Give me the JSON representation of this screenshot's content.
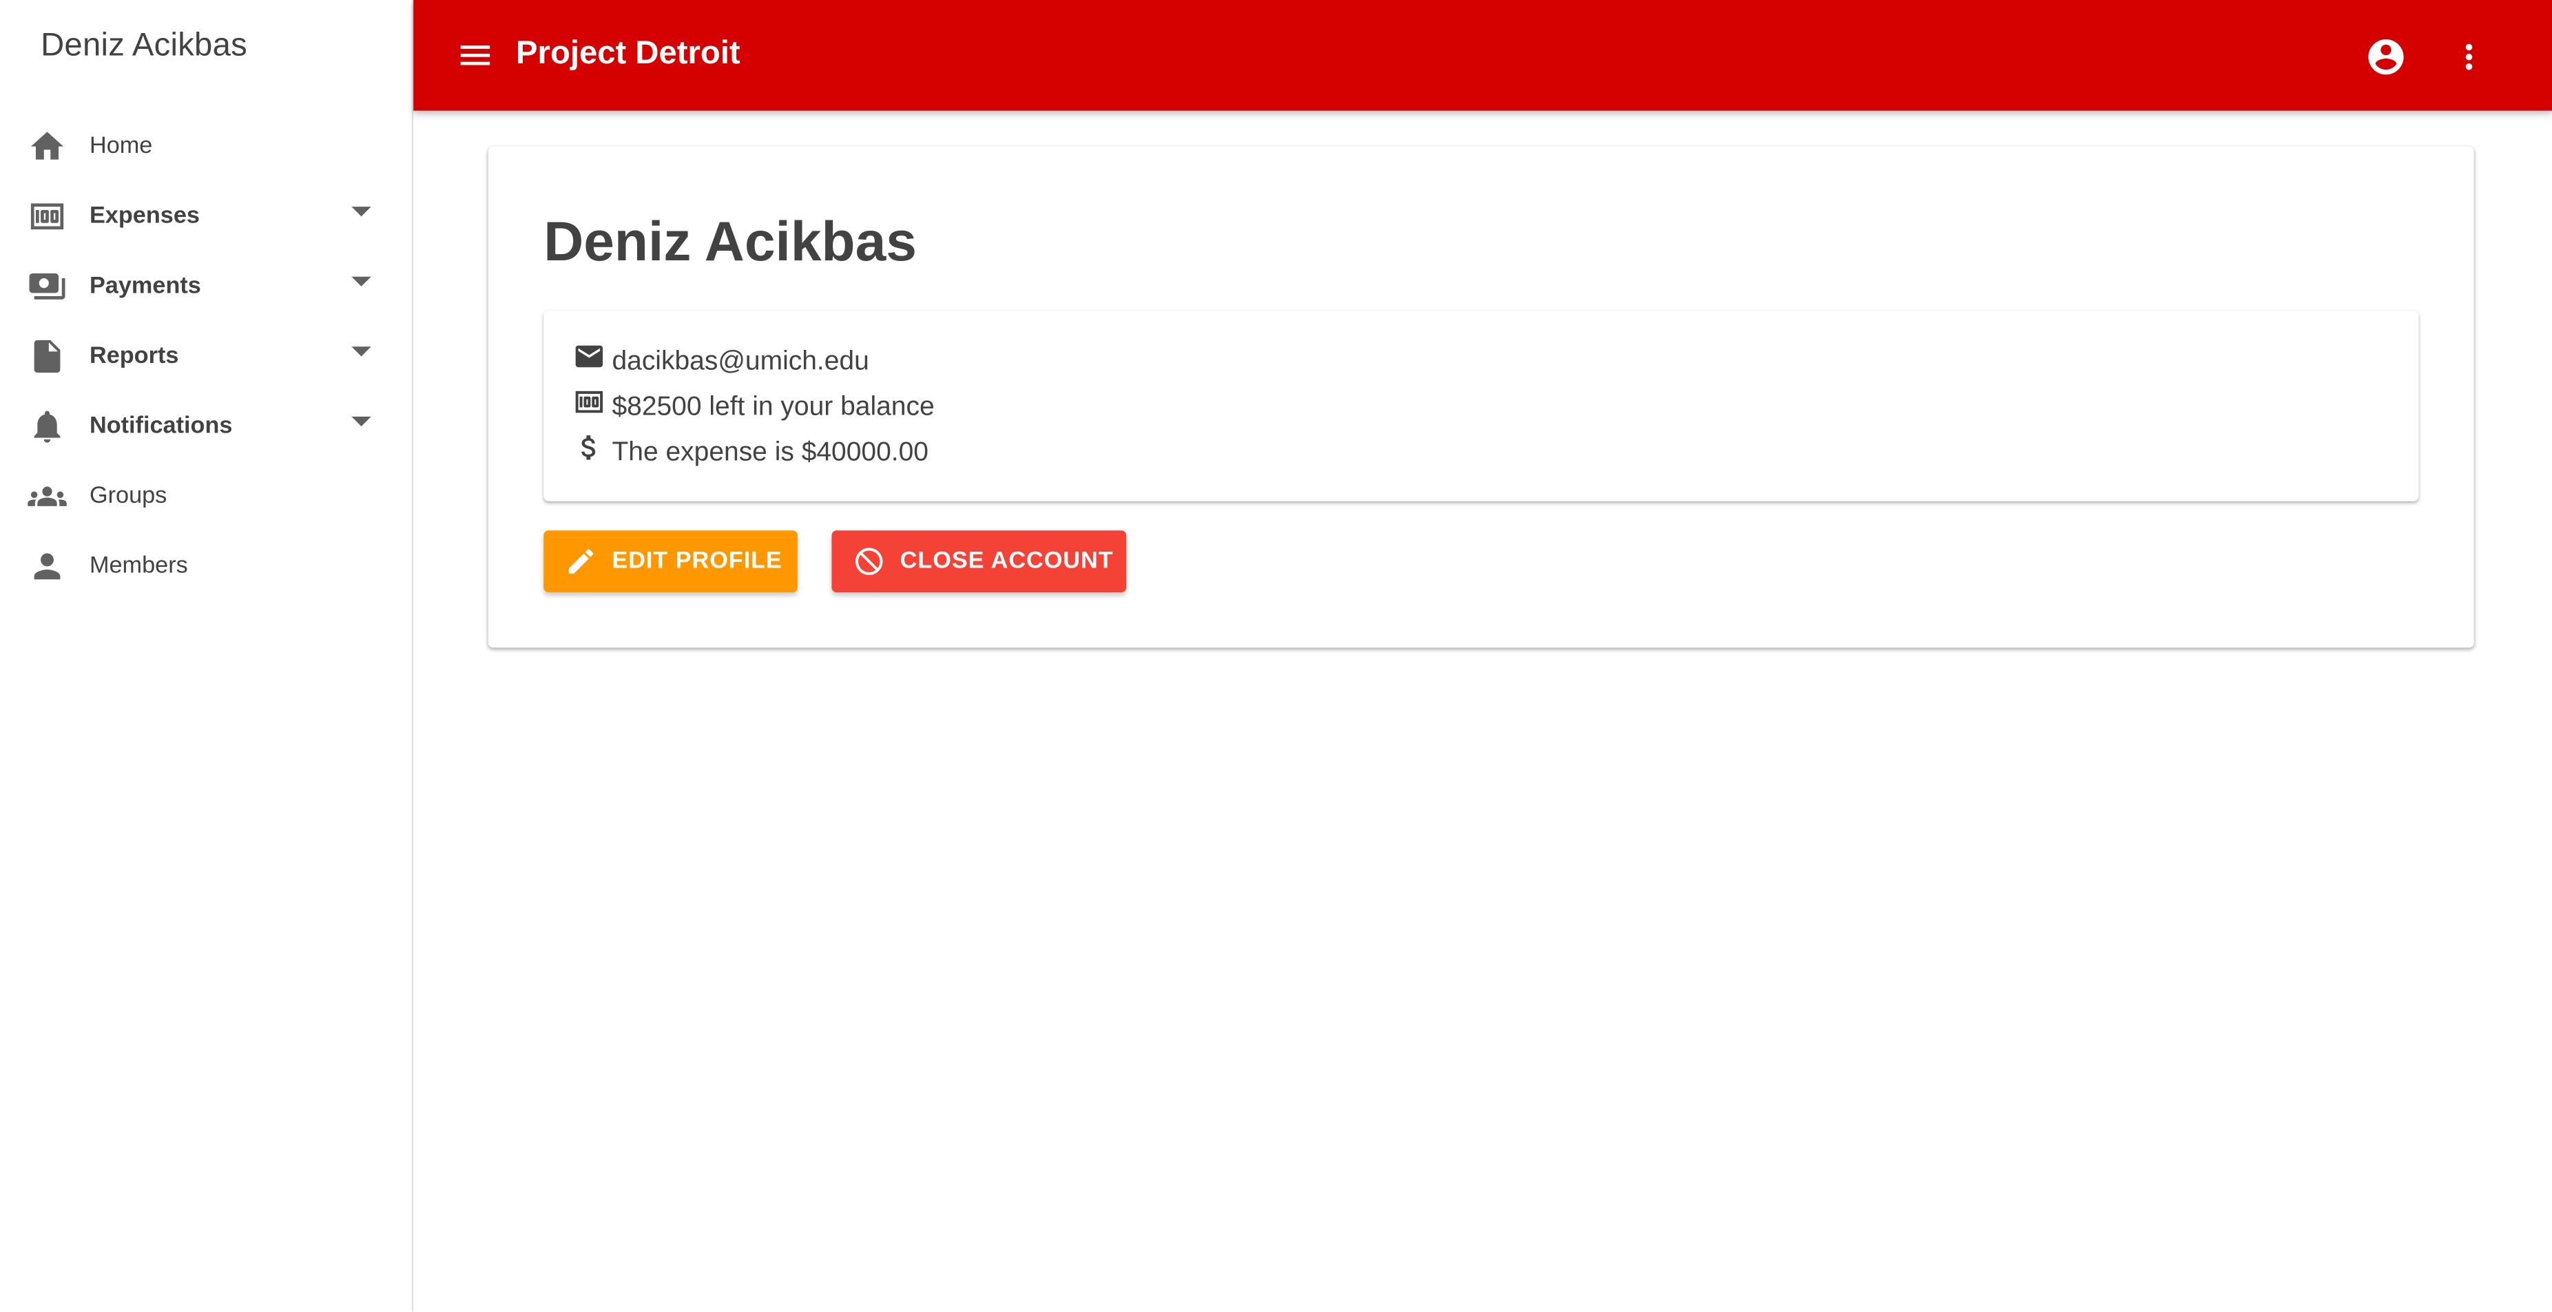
{
  "sidebar": {
    "title": "Deniz Acikbas",
    "items": [
      {
        "label": "Home",
        "icon": "home-icon",
        "expandable": false
      },
      {
        "label": "Expenses",
        "icon": "money-icon",
        "expandable": true
      },
      {
        "label": "Payments",
        "icon": "payments-icon",
        "expandable": true
      },
      {
        "label": "Reports",
        "icon": "document-icon",
        "expandable": true
      },
      {
        "label": "Notifications",
        "icon": "bell-icon",
        "expandable": true
      },
      {
        "label": "Groups",
        "icon": "groups-icon",
        "expandable": false
      },
      {
        "label": "Members",
        "icon": "person-icon",
        "expandable": false
      }
    ]
  },
  "appbar": {
    "title": "Project Detroit",
    "color": "#d50000"
  },
  "profile": {
    "name": "Deniz Acikbas",
    "email": "dacikbas@umich.edu",
    "balance": "$82500 left in your balance",
    "expense": "The expense is $40000.00"
  },
  "actions": {
    "edit_label": "EDIT PROFILE",
    "close_label": "CLOSE ACCOUNT",
    "edit_color": "#ff9800",
    "close_color": "#f44336"
  }
}
